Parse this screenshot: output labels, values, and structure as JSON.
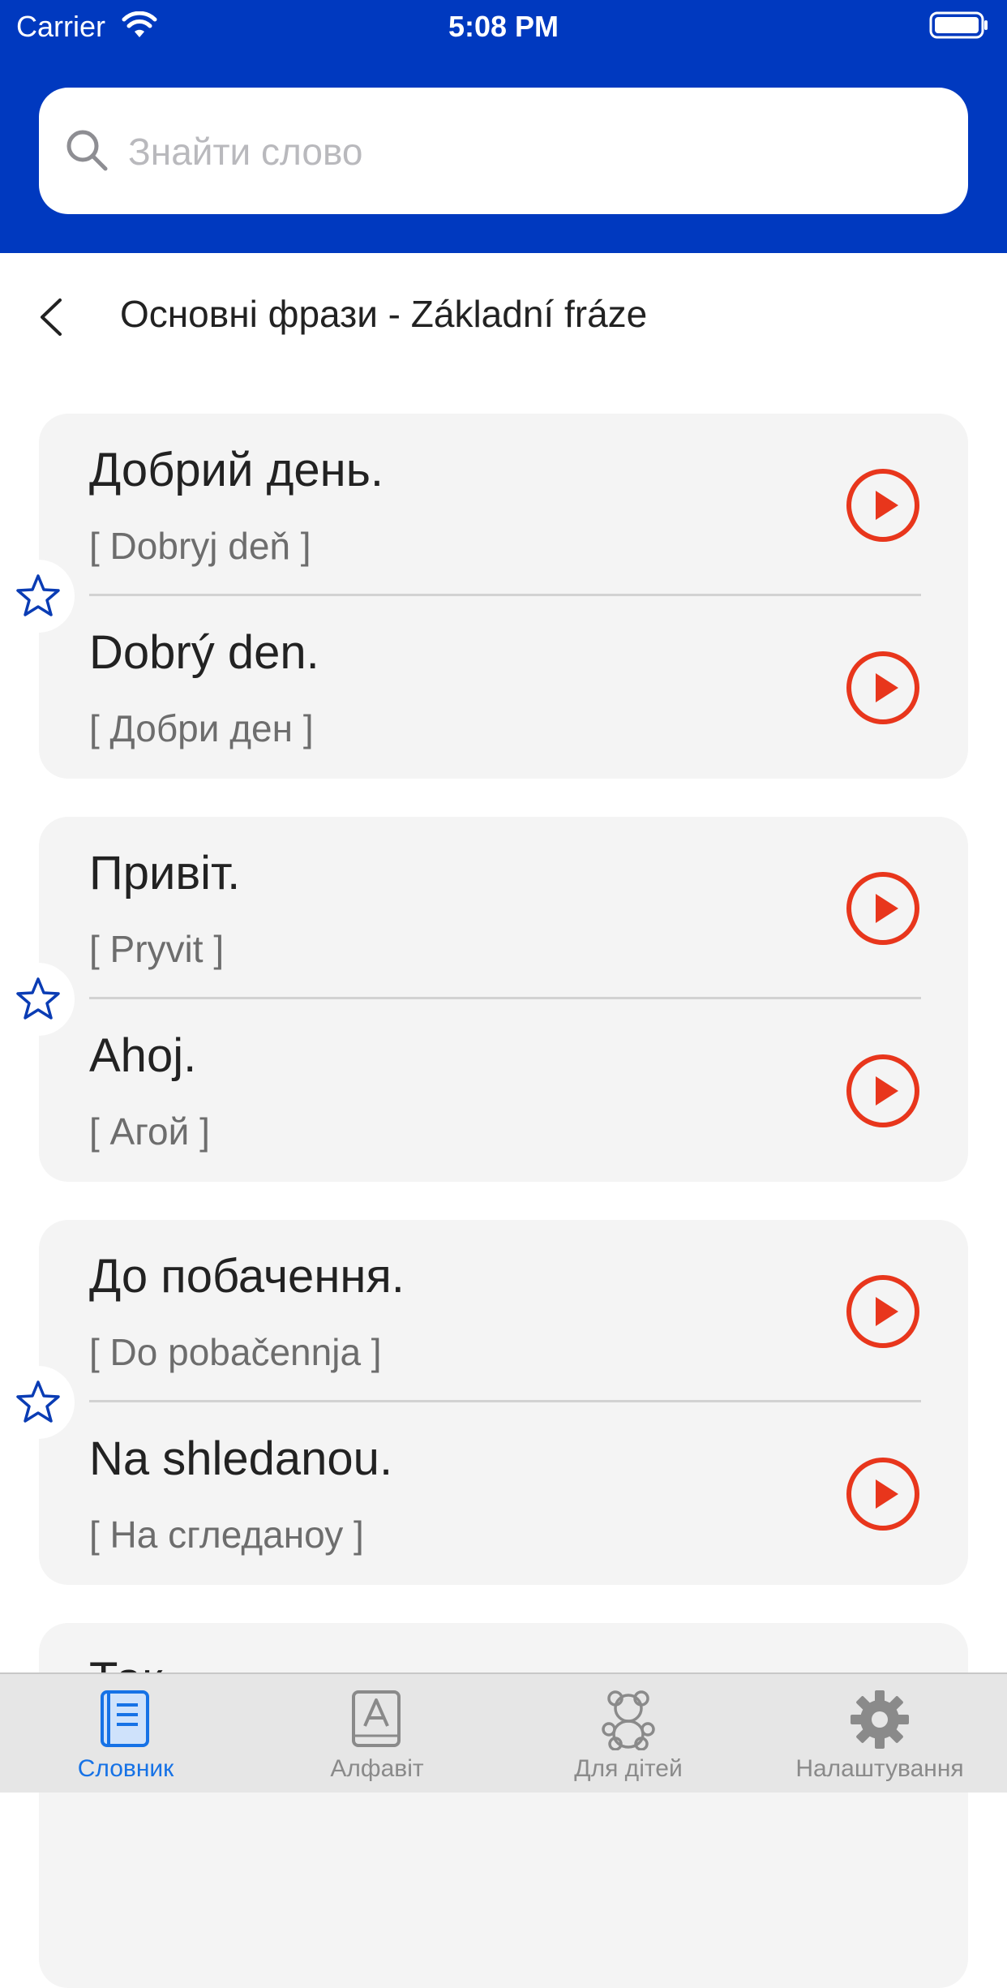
{
  "status_bar": {
    "carrier": "Carrier",
    "time": "5:08 PM"
  },
  "search": {
    "placeholder": "Знайти слово"
  },
  "nav": {
    "title": "Основні фрази - Základní fráze"
  },
  "cards": [
    {
      "top": {
        "phrase": "Добрий день.",
        "transliteration": "[ Dobryj deň ]"
      },
      "bottom": {
        "phrase": "Dobrý den.",
        "transliteration": "[ Добри ден ]"
      }
    },
    {
      "top": {
        "phrase": "Привіт.",
        "transliteration": "[ Pryvit ]"
      },
      "bottom": {
        "phrase": "Ahoj.",
        "transliteration": "[ Агой ]"
      }
    },
    {
      "top": {
        "phrase": "До побачення.",
        "transliteration": "[ Do pobačennja ]"
      },
      "bottom": {
        "phrase": "Na shledanou.",
        "transliteration": "[ На сгледаноу ]"
      }
    },
    {
      "top": {
        "phrase": "Так.",
        "transliteration": ""
      }
    }
  ],
  "tabs": [
    {
      "label": "Словник",
      "icon": "book-icon",
      "active": true
    },
    {
      "label": "Алфавіт",
      "icon": "alphabet-book-icon",
      "active": false
    },
    {
      "label": "Для дітей",
      "icon": "teddy-bear-icon",
      "active": false
    },
    {
      "label": "Налаштування",
      "icon": "gear-icon",
      "active": false
    }
  ],
  "colors": {
    "header_blue": "#0039BF",
    "play_red": "#E8361C",
    "star_blue": "#0A3CB4",
    "tab_active": "#1672E6"
  }
}
